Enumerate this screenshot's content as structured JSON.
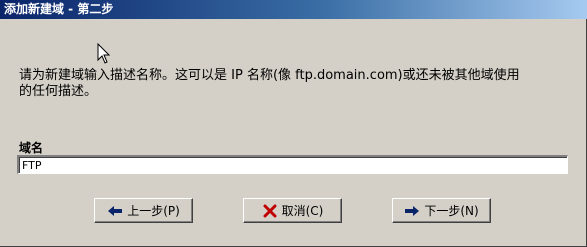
{
  "window": {
    "title": "添加新建域 - 第二步"
  },
  "main": {
    "description_line1": "请为新建域输入描述名称。这可以是 IP 名称(像 ftp.domain.com)或还未被其他域使用",
    "description_line2": "的任何描述。",
    "domain_label": "域名",
    "domain_value": "FTP"
  },
  "buttons": {
    "back_label": "上一步(P)",
    "cancel_label": "取消(C)",
    "next_label": "下一步(N)"
  },
  "icons": {
    "back": "left-arrow-icon",
    "cancel": "red-x-icon",
    "next": "right-arrow-icon"
  },
  "colors": {
    "titlebar_start": "#0a246a",
    "titlebar_end": "#a6caf0",
    "window_bg": "#d4d0c8",
    "arrow_blue": "#0a246a",
    "cancel_red": "#c00000"
  }
}
